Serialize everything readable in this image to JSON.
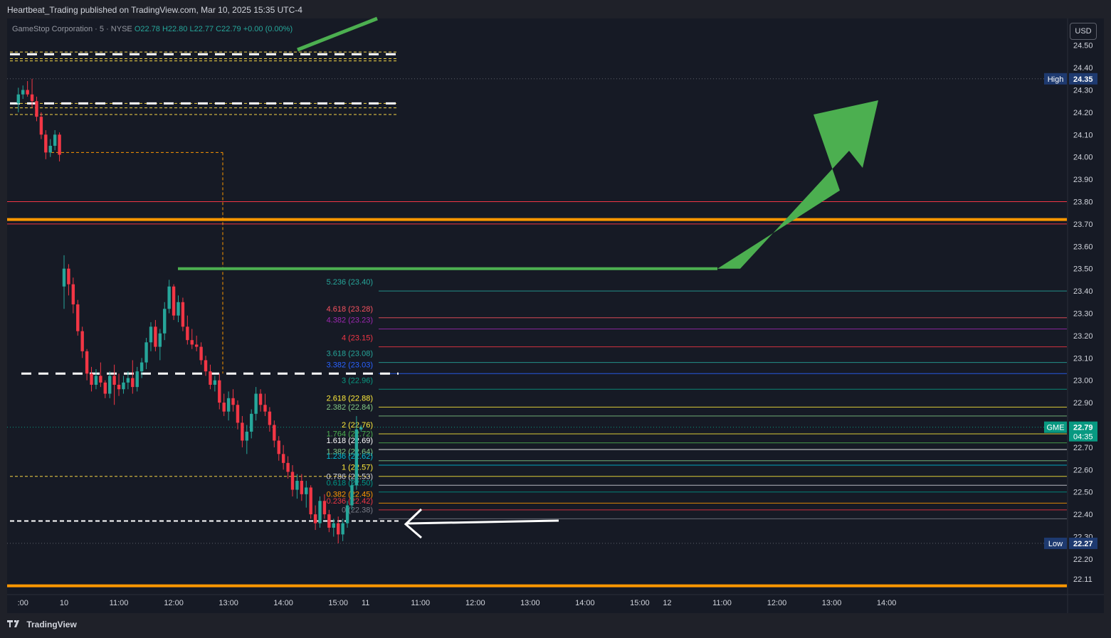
{
  "header": {
    "published": "Heartbeat_Trading published on TradingView.com, Mar 10, 2025 15:35 UTC-4"
  },
  "footer": {
    "brand": "TradingView",
    "logo_icon": "tradingview-logo-icon"
  },
  "currency_button": "USD",
  "legend": {
    "symbol": "GameStop Corporation · 5 · NYSE",
    "ohlc": "O22.78 H22.80 L22.77 C22.79 +0.00 (0.00%)"
  },
  "colors": {
    "up": "#26a69a",
    "down": "#f23645",
    "background": "#161a25",
    "accent_orange": "#ff9800",
    "arrow_green": "#4caf50"
  },
  "chart_data": {
    "type": "candlestick",
    "ylim": [
      22.05,
      24.62
    ],
    "y_ticks": [
      24.5,
      24.4,
      24.3,
      24.2,
      24.1,
      24.0,
      23.9,
      23.8,
      23.7,
      23.6,
      23.5,
      23.4,
      23.3,
      23.2,
      23.1,
      23.0,
      22.9,
      22.7,
      22.6,
      22.5,
      22.4,
      22.3,
      22.2,
      22.11
    ],
    "y_tick_labels": [
      "24.50",
      "24.40",
      "24.30",
      "24.20",
      "24.10",
      "24.00",
      "23.90",
      "23.80",
      "23.70",
      "23.60",
      "23.50",
      "23.40",
      "23.30",
      "23.20",
      "23.10",
      "23.00",
      "22.90",
      "22.70",
      "22.60",
      "22.50",
      "22.40",
      "22.30",
      "22.20",
      "22.11"
    ],
    "x_labels": [
      ":00",
      "10",
      "11:00",
      "12:00",
      "13:00",
      "14:00",
      "15:00",
      "11",
      "11:00",
      "12:00",
      "13:00",
      "14:00",
      "15:00",
      "12",
      "11:00",
      "12:00",
      "13:00",
      "14:00"
    ],
    "x_label_index": [
      -9,
      0,
      12,
      24,
      36,
      48,
      60,
      66,
      78,
      90,
      102,
      114,
      126,
      132,
      144,
      156,
      168,
      180
    ],
    "candles": [
      [
        -10,
        24.24,
        24.31,
        24.2,
        24.28
      ],
      [
        -9,
        24.28,
        24.32,
        24.26,
        24.3
      ],
      [
        -8,
        24.3,
        24.34,
        24.27,
        24.28
      ],
      [
        -7,
        24.28,
        24.35,
        24.22,
        24.25
      ],
      [
        -6,
        24.25,
        24.27,
        24.16,
        24.18
      ],
      [
        -5,
        24.18,
        24.2,
        24.08,
        24.1
      ],
      [
        -4,
        24.1,
        24.12,
        23.99,
        24.02
      ],
      [
        -3,
        24.02,
        24.08,
        24.0,
        24.05
      ],
      [
        -2,
        24.05,
        24.12,
        24.03,
        24.1
      ],
      [
        -1,
        24.1,
        24.11,
        23.98,
        24.01
      ],
      [
        0,
        23.42,
        23.56,
        23.32,
        23.5
      ],
      [
        1,
        23.5,
        23.52,
        23.38,
        23.43
      ],
      [
        2,
        23.43,
        23.46,
        23.3,
        23.34
      ],
      [
        3,
        23.34,
        23.36,
        23.2,
        23.22
      ],
      [
        4,
        23.22,
        23.24,
        23.1,
        23.13
      ],
      [
        5,
        23.13,
        23.14,
        23.0,
        23.03
      ],
      [
        6,
        23.03,
        23.06,
        22.95,
        22.98
      ],
      [
        7,
        22.98,
        23.05,
        22.96,
        23.02
      ],
      [
        8,
        23.02,
        23.08,
        22.97,
        22.99
      ],
      [
        9,
        22.99,
        23.0,
        22.92,
        22.94
      ],
      [
        10,
        22.94,
        23.04,
        22.92,
        23.02
      ],
      [
        11,
        23.02,
        23.07,
        22.89,
        22.98
      ],
      [
        12,
        22.98,
        23.03,
        22.93,
        22.96
      ],
      [
        13,
        22.96,
        23.02,
        22.94,
        22.99
      ],
      [
        14,
        22.99,
        23.04,
        22.96,
        23.01
      ],
      [
        15,
        23.01,
        23.09,
        22.94,
        22.97
      ],
      [
        16,
        22.97,
        23.06,
        22.95,
        23.04
      ],
      [
        17,
        23.04,
        23.1,
        23.01,
        23.08
      ],
      [
        18,
        23.08,
        23.19,
        23.05,
        23.17
      ],
      [
        19,
        23.17,
        23.26,
        23.13,
        23.24
      ],
      [
        20,
        23.24,
        23.27,
        23.13,
        23.15
      ],
      [
        21,
        23.15,
        23.23,
        23.09,
        23.21
      ],
      [
        22,
        23.21,
        23.35,
        23.18,
        23.32
      ],
      [
        23,
        23.32,
        23.45,
        23.3,
        23.42
      ],
      [
        24,
        23.42,
        23.43,
        23.27,
        23.29
      ],
      [
        25,
        23.29,
        23.38,
        23.26,
        23.35
      ],
      [
        26,
        23.35,
        23.37,
        23.22,
        23.24
      ],
      [
        27,
        23.24,
        23.29,
        23.16,
        23.18
      ],
      [
        28,
        23.18,
        23.23,
        23.14,
        23.16
      ],
      [
        29,
        23.16,
        23.2,
        23.13,
        23.15
      ],
      [
        30,
        23.15,
        23.17,
        23.07,
        23.09
      ],
      [
        31,
        23.09,
        23.11,
        23.02,
        23.04
      ],
      [
        32,
        23.04,
        23.07,
        22.96,
        22.98
      ],
      [
        33,
        22.98,
        23.02,
        22.95,
        23.0
      ],
      [
        34,
        23.0,
        23.03,
        22.87,
        22.9
      ],
      [
        35,
        22.9,
        22.94,
        22.84,
        22.86
      ],
      [
        36,
        22.86,
        22.95,
        22.82,
        22.92
      ],
      [
        37,
        22.92,
        22.96,
        22.86,
        22.89
      ],
      [
        38,
        22.89,
        22.91,
        22.78,
        22.81
      ],
      [
        39,
        22.81,
        22.84,
        22.7,
        22.73
      ],
      [
        40,
        22.73,
        22.8,
        22.67,
        22.77
      ],
      [
        41,
        22.77,
        22.87,
        22.74,
        22.85
      ],
      [
        42,
        22.85,
        22.97,
        22.82,
        22.94
      ],
      [
        43,
        22.94,
        22.96,
        22.86,
        22.89
      ],
      [
        44,
        22.89,
        22.94,
        22.84,
        22.86
      ],
      [
        45,
        22.86,
        22.88,
        22.77,
        22.8
      ],
      [
        46,
        22.8,
        22.82,
        22.7,
        22.73
      ],
      [
        47,
        22.73,
        22.75,
        22.64,
        22.67
      ],
      [
        48,
        22.67,
        22.71,
        22.6,
        22.63
      ],
      [
        49,
        22.63,
        22.66,
        22.56,
        22.59
      ],
      [
        50,
        22.59,
        22.62,
        22.48,
        22.51
      ],
      [
        51,
        22.51,
        22.58,
        22.47,
        22.55
      ],
      [
        52,
        22.55,
        22.58,
        22.46,
        22.49
      ],
      [
        53,
        22.49,
        22.55,
        22.43,
        22.52
      ],
      [
        54,
        22.52,
        22.53,
        22.38,
        22.4
      ],
      [
        55,
        22.4,
        22.44,
        22.33,
        22.36
      ],
      [
        56,
        22.36,
        22.48,
        22.34,
        22.46
      ],
      [
        57,
        22.46,
        22.49,
        22.38,
        22.4
      ],
      [
        58,
        22.4,
        22.42,
        22.32,
        22.34
      ],
      [
        59,
        22.34,
        22.38,
        22.3,
        22.36
      ],
      [
        60,
        22.36,
        22.39,
        22.27,
        22.31
      ],
      [
        61,
        22.31,
        22.38,
        22.28,
        22.36
      ],
      [
        62,
        22.36,
        22.46,
        22.34,
        22.44
      ],
      [
        63,
        22.44,
        22.56,
        22.42,
        22.53
      ],
      [
        64,
        22.53,
        22.84,
        22.51,
        22.78
      ],
      [
        65,
        22.78,
        22.8,
        22.77,
        22.79
      ]
    ],
    "fib_levels": [
      {
        "label": "5.236 (23.40)",
        "value": 23.4,
        "color": "#26a69a"
      },
      {
        "label": "4.618 (23.28)",
        "value": 23.28,
        "color": "#f7525f"
      },
      {
        "label": "4.382 (23.23)",
        "value": 23.23,
        "color": "#9c27b0"
      },
      {
        "label": "4 (23.15)",
        "value": 23.15,
        "color": "#f23645"
      },
      {
        "label": "3.618 (23.08)",
        "value": 23.08,
        "color": "#26a69a"
      },
      {
        "label": "3.382 (23.03)",
        "value": 23.03,
        "color": "#2962ff"
      },
      {
        "label": "3 (22.96)",
        "value": 22.96,
        "color": "#089981"
      },
      {
        "label": "2.618 (22.88)",
        "value": 22.88,
        "color": "#ffeb3b"
      },
      {
        "label": "2.382 (22.84)",
        "value": 22.84,
        "color": "#81c784"
      },
      {
        "label": "2 (22.76)",
        "value": 22.76,
        "color": "#ffeb3b"
      },
      {
        "label": "1.764 (22.72)",
        "value": 22.72,
        "color": "#4caf50"
      },
      {
        "label": "1.618 (22.69)",
        "value": 22.69,
        "color": "#ffffff"
      },
      {
        "label": "1.382 (22.64)",
        "value": 22.64,
        "color": "#81c784"
      },
      {
        "label": "1.236 (22.62)",
        "value": 22.62,
        "color": "#00bcd4"
      },
      {
        "label": "1 (22.57)",
        "value": 22.57,
        "color": "#ffeb3b"
      },
      {
        "label": "0.786 (22.53)",
        "value": 22.53,
        "color": "#d1d4dc"
      },
      {
        "label": "0.618 (22.50)",
        "value": 22.5,
        "color": "#009688"
      },
      {
        "label": "0.382 (22.45)",
        "value": 22.45,
        "color": "#ff9800"
      },
      {
        "label": "0.236 (22.42)",
        "value": 22.42,
        "color": "#f23645"
      },
      {
        "label": "0 (22.38)",
        "value": 22.38,
        "color": "#787b86"
      }
    ],
    "horizontal_lines": [
      {
        "value": 23.8,
        "color": "#f23645",
        "style": "solid",
        "weight": 1
      },
      {
        "value": 23.72,
        "color": "#ff9800",
        "style": "solid",
        "weight": 4
      },
      {
        "value": 23.7,
        "color": "#f23645",
        "style": "solid",
        "weight": 1
      },
      {
        "value": 22.08,
        "color": "#ff9800",
        "style": "solid",
        "weight": 4
      }
    ],
    "price_badges": [
      {
        "label": "High",
        "value": "24.35",
        "price": 24.35,
        "bg": "#1e3a70"
      },
      {
        "label": "GME",
        "value": "22.79",
        "sub": "04:35",
        "price": 22.79,
        "bg": "#089981"
      },
      {
        "label": "Low",
        "value": "22.27",
        "price": 22.27,
        "bg": "#1e3a70"
      }
    ]
  }
}
